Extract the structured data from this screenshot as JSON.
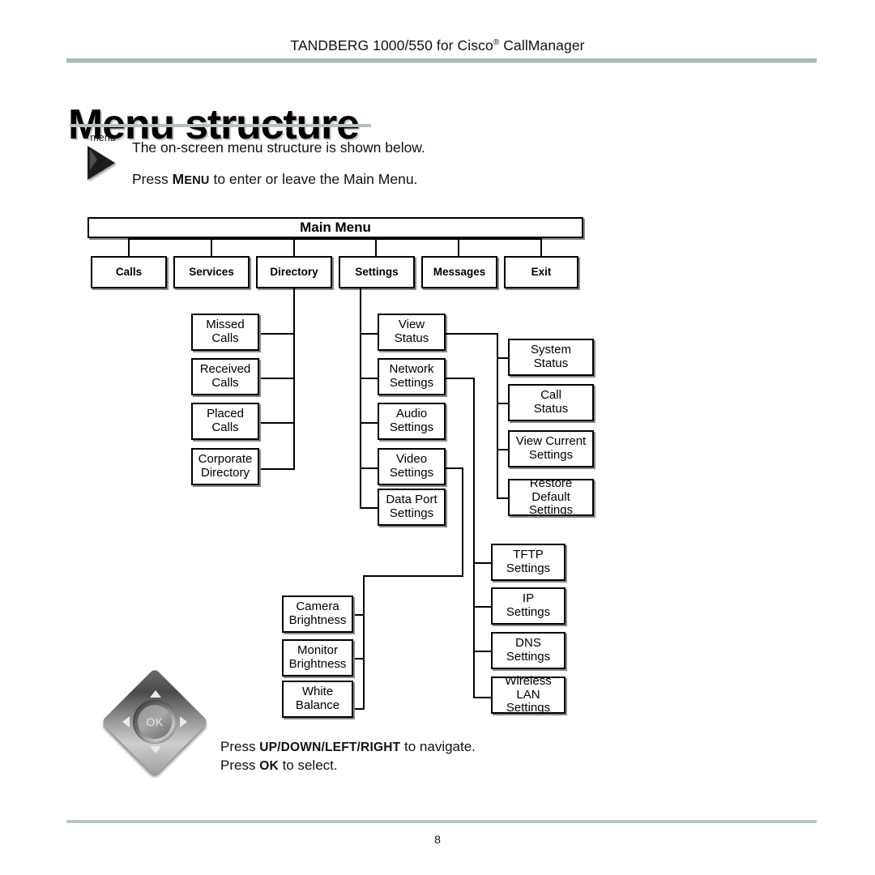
{
  "header": {
    "running_title_prefix": "TANDBERG 1000/550 for Cisco",
    "running_title_reg": "®",
    "running_title_suffix": " CallManager"
  },
  "page_title": "Menu structure",
  "intro": {
    "menu_key_label": "menu",
    "line1": "The on-screen menu structure is shown below.",
    "line2_pre": "Press ",
    "line2_key_cap": "M",
    "line2_key_rest": "ENU",
    "line2_post": " to enter or leave the Main Menu."
  },
  "diagram": {
    "root": {
      "label": "Main Menu"
    },
    "level1": [
      {
        "label": "Calls"
      },
      {
        "label": "Services"
      },
      {
        "label": "Directory"
      },
      {
        "label": "Settings"
      },
      {
        "label": "Messages"
      },
      {
        "label": "Exit"
      }
    ],
    "directory_children": [
      {
        "line1": "Missed",
        "line2": "Calls"
      },
      {
        "line1": "Received",
        "line2": "Calls"
      },
      {
        "line1": "Placed",
        "line2": "Calls"
      },
      {
        "line1": "Corporate",
        "line2": "Directory"
      }
    ],
    "settings_children": [
      {
        "line1": "View",
        "line2": "Status"
      },
      {
        "line1": "Network",
        "line2": "Settings"
      },
      {
        "line1": "Audio",
        "line2": "Settings"
      },
      {
        "line1": "Video",
        "line2": "Settings"
      },
      {
        "line1": "Data Port",
        "line2": "Settings"
      }
    ],
    "view_status_children": [
      {
        "line1": "System",
        "line2": "Status"
      },
      {
        "line1": "Call",
        "line2": "Status"
      },
      {
        "line1": "View Current",
        "line2": "Settings"
      },
      {
        "line1": "Restore Default",
        "line2": "Settings"
      }
    ],
    "network_settings_children": [
      {
        "line1": "TFTP",
        "line2": "Settings"
      },
      {
        "line1": "IP",
        "line2": "Settings"
      },
      {
        "line1": "DNS",
        "line2": "Settings"
      },
      {
        "line1": "Wireless LAN",
        "line2": "Settings"
      }
    ],
    "video_settings_children": [
      {
        "line1": "Camera",
        "line2": "Brightness"
      },
      {
        "line1": "Monitor",
        "line2": "Brightness"
      },
      {
        "line1": "White",
        "line2": "Balance"
      }
    ]
  },
  "navpad": {
    "ok_label": "OK",
    "instruction_1_pre": "Press ",
    "instruction_1_keys": "UP/DOWN/LEFT/RIGHT",
    "instruction_1_post": " to navigate.",
    "instruction_2_pre": "Press ",
    "instruction_2_key": "OK",
    "instruction_2_post": " to select."
  },
  "footer": {
    "page_number": "8"
  },
  "colors": {
    "rule": "#a9b9b8",
    "box_border": "#000000",
    "box_shadow": "#8a8a8a",
    "text": "#000000"
  }
}
